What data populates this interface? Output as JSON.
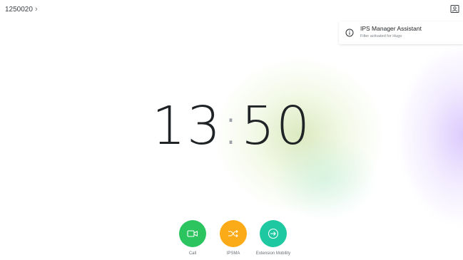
{
  "header": {
    "extension": "1250020",
    "chevron": "chevron-right-icon"
  },
  "contact_icon": "contacts-icon",
  "notification": {
    "icon": "info-icon",
    "title": "IPS Manager Assistant",
    "subtitle": "Filter activated for Hugo"
  },
  "clock": {
    "hours": "13",
    "separator": ":",
    "minutes": "50"
  },
  "actions": [
    {
      "label": "Call",
      "icon": "video-camera-icon",
      "color": "#2bc45f"
    },
    {
      "label": "IPSMA",
      "icon": "shuffle-icon",
      "color": "#fbab18"
    },
    {
      "label": "Extension Mobility",
      "icon": "sign-in-icon",
      "color": "#1ec8a0"
    }
  ]
}
